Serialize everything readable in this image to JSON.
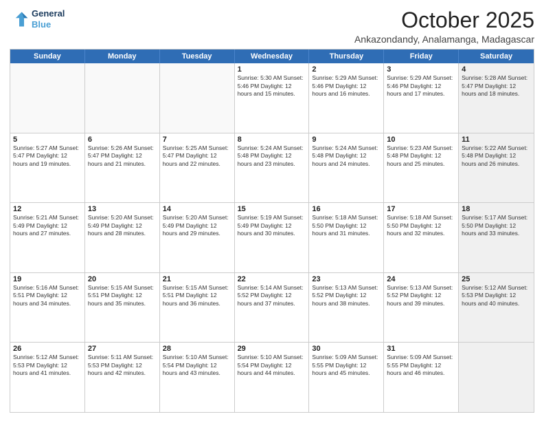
{
  "logo": {
    "line1": "General",
    "line2": "Blue"
  },
  "title": "October 2025",
  "location": "Ankazondandy, Analamanga, Madagascar",
  "dayHeaders": [
    "Sunday",
    "Monday",
    "Tuesday",
    "Wednesday",
    "Thursday",
    "Friday",
    "Saturday"
  ],
  "weeks": [
    [
      {
        "day": "",
        "info": "",
        "empty": true
      },
      {
        "day": "",
        "info": "",
        "empty": true
      },
      {
        "day": "",
        "info": "",
        "empty": true
      },
      {
        "day": "1",
        "info": "Sunrise: 5:30 AM\nSunset: 5:46 PM\nDaylight: 12 hours\nand 15 minutes."
      },
      {
        "day": "2",
        "info": "Sunrise: 5:29 AM\nSunset: 5:46 PM\nDaylight: 12 hours\nand 16 minutes."
      },
      {
        "day": "3",
        "info": "Sunrise: 5:29 AM\nSunset: 5:46 PM\nDaylight: 12 hours\nand 17 minutes."
      },
      {
        "day": "4",
        "info": "Sunrise: 5:28 AM\nSunset: 5:47 PM\nDaylight: 12 hours\nand 18 minutes.",
        "shaded": true
      }
    ],
    [
      {
        "day": "5",
        "info": "Sunrise: 5:27 AM\nSunset: 5:47 PM\nDaylight: 12 hours\nand 19 minutes."
      },
      {
        "day": "6",
        "info": "Sunrise: 5:26 AM\nSunset: 5:47 PM\nDaylight: 12 hours\nand 21 minutes."
      },
      {
        "day": "7",
        "info": "Sunrise: 5:25 AM\nSunset: 5:47 PM\nDaylight: 12 hours\nand 22 minutes."
      },
      {
        "day": "8",
        "info": "Sunrise: 5:24 AM\nSunset: 5:48 PM\nDaylight: 12 hours\nand 23 minutes."
      },
      {
        "day": "9",
        "info": "Sunrise: 5:24 AM\nSunset: 5:48 PM\nDaylight: 12 hours\nand 24 minutes."
      },
      {
        "day": "10",
        "info": "Sunrise: 5:23 AM\nSunset: 5:48 PM\nDaylight: 12 hours\nand 25 minutes."
      },
      {
        "day": "11",
        "info": "Sunrise: 5:22 AM\nSunset: 5:48 PM\nDaylight: 12 hours\nand 26 minutes.",
        "shaded": true
      }
    ],
    [
      {
        "day": "12",
        "info": "Sunrise: 5:21 AM\nSunset: 5:49 PM\nDaylight: 12 hours\nand 27 minutes."
      },
      {
        "day": "13",
        "info": "Sunrise: 5:20 AM\nSunset: 5:49 PM\nDaylight: 12 hours\nand 28 minutes."
      },
      {
        "day": "14",
        "info": "Sunrise: 5:20 AM\nSunset: 5:49 PM\nDaylight: 12 hours\nand 29 minutes."
      },
      {
        "day": "15",
        "info": "Sunrise: 5:19 AM\nSunset: 5:49 PM\nDaylight: 12 hours\nand 30 minutes."
      },
      {
        "day": "16",
        "info": "Sunrise: 5:18 AM\nSunset: 5:50 PM\nDaylight: 12 hours\nand 31 minutes."
      },
      {
        "day": "17",
        "info": "Sunrise: 5:18 AM\nSunset: 5:50 PM\nDaylight: 12 hours\nand 32 minutes."
      },
      {
        "day": "18",
        "info": "Sunrise: 5:17 AM\nSunset: 5:50 PM\nDaylight: 12 hours\nand 33 minutes.",
        "shaded": true
      }
    ],
    [
      {
        "day": "19",
        "info": "Sunrise: 5:16 AM\nSunset: 5:51 PM\nDaylight: 12 hours\nand 34 minutes."
      },
      {
        "day": "20",
        "info": "Sunrise: 5:15 AM\nSunset: 5:51 PM\nDaylight: 12 hours\nand 35 minutes."
      },
      {
        "day": "21",
        "info": "Sunrise: 5:15 AM\nSunset: 5:51 PM\nDaylight: 12 hours\nand 36 minutes."
      },
      {
        "day": "22",
        "info": "Sunrise: 5:14 AM\nSunset: 5:52 PM\nDaylight: 12 hours\nand 37 minutes."
      },
      {
        "day": "23",
        "info": "Sunrise: 5:13 AM\nSunset: 5:52 PM\nDaylight: 12 hours\nand 38 minutes."
      },
      {
        "day": "24",
        "info": "Sunrise: 5:13 AM\nSunset: 5:52 PM\nDaylight: 12 hours\nand 39 minutes."
      },
      {
        "day": "25",
        "info": "Sunrise: 5:12 AM\nSunset: 5:53 PM\nDaylight: 12 hours\nand 40 minutes.",
        "shaded": true
      }
    ],
    [
      {
        "day": "26",
        "info": "Sunrise: 5:12 AM\nSunset: 5:53 PM\nDaylight: 12 hours\nand 41 minutes."
      },
      {
        "day": "27",
        "info": "Sunrise: 5:11 AM\nSunset: 5:53 PM\nDaylight: 12 hours\nand 42 minutes."
      },
      {
        "day": "28",
        "info": "Sunrise: 5:10 AM\nSunset: 5:54 PM\nDaylight: 12 hours\nand 43 minutes."
      },
      {
        "day": "29",
        "info": "Sunrise: 5:10 AM\nSunset: 5:54 PM\nDaylight: 12 hours\nand 44 minutes."
      },
      {
        "day": "30",
        "info": "Sunrise: 5:09 AM\nSunset: 5:55 PM\nDaylight: 12 hours\nand 45 minutes."
      },
      {
        "day": "31",
        "info": "Sunrise: 5:09 AM\nSunset: 5:55 PM\nDaylight: 12 hours\nand 46 minutes."
      },
      {
        "day": "",
        "info": "",
        "empty": true,
        "shaded": true
      }
    ]
  ]
}
